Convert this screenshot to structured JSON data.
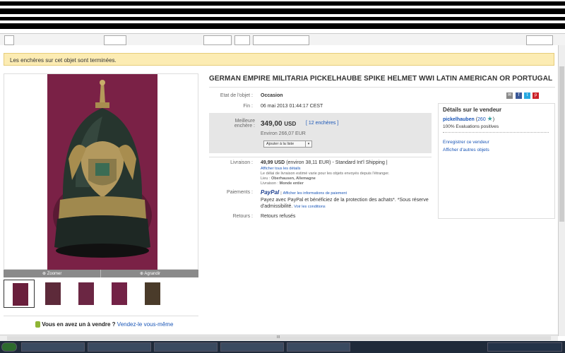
{
  "colors": {
    "accent_link": "#1a56b7",
    "banner_bg": "#fcecb3",
    "photo_bg": "#7a2146",
    "price_box_bg": "#e6e6e6"
  },
  "banner": {
    "text": "Les enchères sur cet objet sont terminées."
  },
  "gallery": {
    "zoom_label": "Zoomer",
    "enlarge_label": "Agrandir",
    "thumbnail_count": 5,
    "selected_index": 0
  },
  "sell": {
    "question": "Vous en avez un à vendre ?",
    "link": "Vendez-le vous-même"
  },
  "listing": {
    "title": "GERMAN EMPIRE MILITARIA PICKELHAUBE SPIKE HELMET WWI LATIN AMERICAN OR PORTUGAL",
    "condition_label": "Etat de l'objet :",
    "condition_value": "Occasion",
    "end_label": "Fin :",
    "end_value": "06 mai 2013 01:44:17 CEST",
    "bid_label_1": "Meilleure",
    "bid_label_2": "enchère :",
    "price": "349,00",
    "currency": "USD",
    "bids_link": "12 enchères",
    "approx": "Environ 266,07 EUR",
    "watch_button": "Ajouter à la liste",
    "shipping_label": "Livraison :",
    "shipping_value": "49,99 USD",
    "shipping_approx": "(environ 38,11 EUR)",
    "shipping_service": "- Standard Int'l Shipping",
    "shipping_details_link": "Afficher tous les détails",
    "shipping_note": "Le délai de livraison estimé varie pour les objets envoyés depuis l'étranger.",
    "location_label": "Lieu :",
    "location_value": "Oberhausen, Allemagne",
    "ships_to_label": "Livraison :",
    "ships_to_value": "Monde entier",
    "payments_label": "Paiements :",
    "paypal_logo": "PayPal",
    "payment_info_link": "Afficher les informations de paiement",
    "payment_text": "Payez avec PayPal et bénéficiez de la protection des achats*. *Sous réserve d'admissibilité.",
    "conditions_link": "Voir les conditions",
    "returns_label": "Retours :",
    "returns_value": "Retours refusés"
  },
  "seller": {
    "heading": "Détails sur le vendeur",
    "name": "pickelhauben",
    "feedback": "260",
    "positive": "100% Evaluations positives",
    "save_link": "Enregistrer ce vendeur",
    "other_items_link": "Afficher d'autres objets"
  },
  "share_icons": [
    "email-icon",
    "facebook-icon",
    "twitter-icon",
    "pinterest-icon"
  ],
  "status_bar": {
    "center_text": "III"
  }
}
